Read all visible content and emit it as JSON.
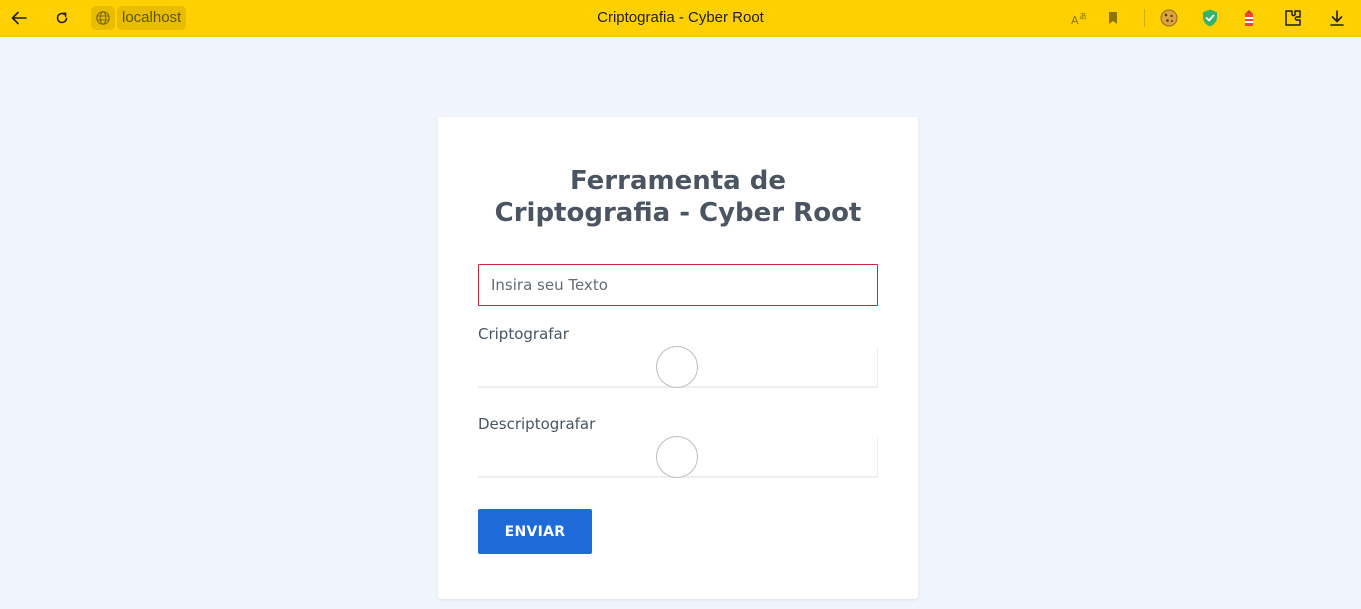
{
  "browser": {
    "address": "localhost",
    "window_title": "Criptografia - Cyber Root",
    "icons": {
      "back": "arrow-left-icon",
      "reload": "reload-icon",
      "site_info": "globe-icon",
      "translate": "translate-icon",
      "bookmark": "bookmark-icon",
      "extensions": [
        "cookie-icon",
        "shield-check-icon",
        "lighthouse-icon",
        "puzzle-icon"
      ],
      "download": "download-icon"
    },
    "bar_color": "#ffd000"
  },
  "form": {
    "title": "Ferramenta de Criptografia - Cyber Root",
    "text_input": {
      "placeholder": "Insira seu Texto",
      "value": ""
    },
    "encrypt_label": "Criptografar",
    "decrypt_label": "Descriptografar",
    "submit_label": "ENVIAR"
  },
  "colors": {
    "page_bg": "#f0f5fd",
    "input_border": "#c8283f",
    "button_bg": "#1d6ad8",
    "title_color": "#4a5561"
  }
}
